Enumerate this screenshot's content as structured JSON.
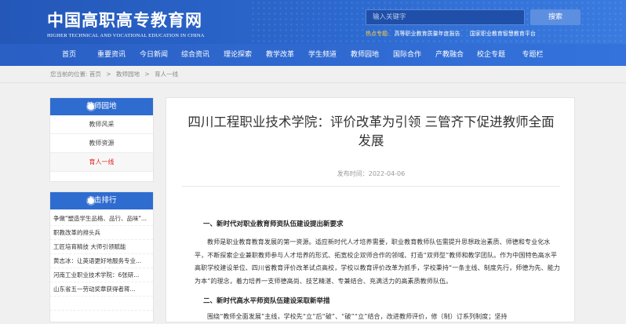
{
  "header": {
    "logo_cn": "中国高职高专教育网",
    "logo_en": "HIGHER TECHNICAL AND VOCATIONAL EDUCATION IN CHINA",
    "search_placeholder": "输入关键字",
    "search_button": "搜索",
    "hot_label": "热点专题:",
    "hot_links": [
      "高等职业教育质量年度报告",
      "国家职业教育智慧教育平台"
    ]
  },
  "nav": [
    "首页",
    "重要资讯",
    "今日新闻",
    "综合资讯",
    "理论探索",
    "教学改革",
    "学生频道",
    "教师园地",
    "国际合作",
    "产教融合",
    "校企专题",
    "专题栏"
  ],
  "breadcrumb": {
    "prefix": "您当前的位置:",
    "items": [
      "首页",
      "教师园地",
      "育人一线"
    ],
    "sep": ">"
  },
  "sidebar": {
    "section1": {
      "title": "教师园地",
      "items": [
        "教师风采",
        "教师资源",
        "育人一线"
      ],
      "active": "育人一线"
    },
    "section2": {
      "title": "点击排行",
      "items": [
        "争做\"塑造学生品格、品行、品味\"...",
        "职教改革的排头兵",
        "工匠培育精技 大师引领赋能",
        "黄志冰：让英语更好地服务专业...",
        "河南工业职业技术学院：6张研...",
        "山东省五一劳动奖章获得者蒋...",
        ""
      ]
    }
  },
  "article": {
    "title": "四川工程职业技术学院：评价改革为引领 三管齐下促进教师全面发展",
    "date": "发布时间：2022-04-06",
    "h1": "一、新时代对职业教育师资队伍建设提出新要求",
    "p1": "教师是职业教育教育发展的第一资源。适应新时代人才培养需要，职业教育教师队伍需提升思想政治素质、师德和专业化水平，不断探索企业兼职教师参与人才培养的形式、拓宽校企双师合作的领域、打造“双师型”教师和教学团队。作为中国特色高水平高职学校建设单位、四川省教育评价改革试点高校，学校以教育评价改革为抓手，学校秉持“一条主线、制度先行，师德为先、能力为本”的理念，着力培养一支师德高尚、技艺精湛、专兼结合、充满活力的高素质教师队伍。",
    "h2": "二、新时代高水平师资队伍建设采取新举措",
    "p2": "围绕“教师全面发展”主线，学校先“立”后“破”、“破”“立”结合，改进教师评价，修（制）订系列制度；坚持"
  }
}
